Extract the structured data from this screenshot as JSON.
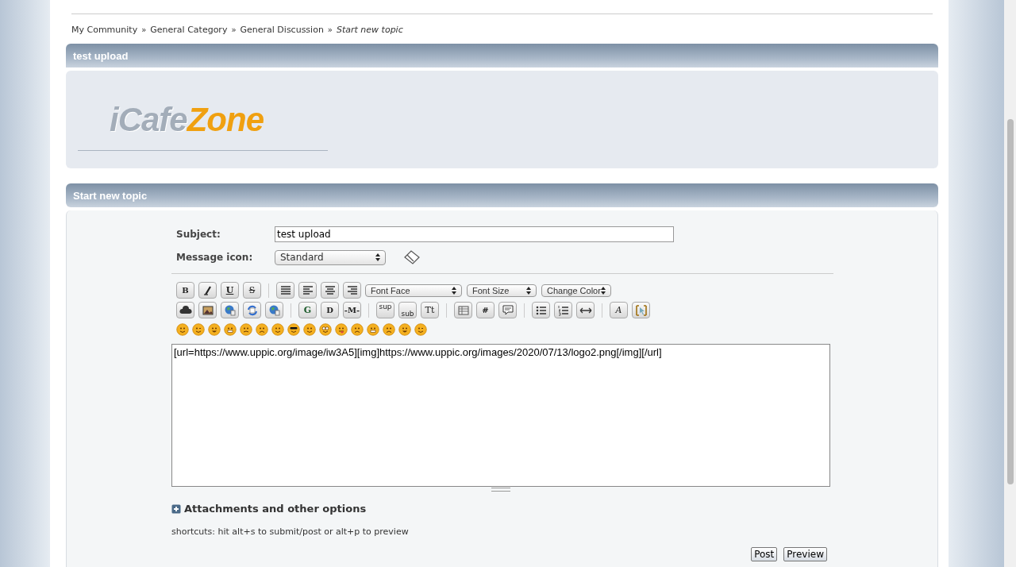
{
  "breadcrumb": [
    {
      "label": "My Community",
      "current": false
    },
    {
      "label": "General Category",
      "current": false
    },
    {
      "label": "General Discussion",
      "current": false
    },
    {
      "label": "Start new topic",
      "current": true
    }
  ],
  "breadcrumb_separator": "»",
  "topic_header": {
    "title": "test upload"
  },
  "logo": {
    "part_1": "iCafe",
    "part_2": "Zone"
  },
  "form_header": {
    "title": "Start new topic"
  },
  "subject": {
    "label": "Subject:",
    "value": "test upload"
  },
  "message_icon": {
    "label": "Message icon:",
    "value": "Standard"
  },
  "toolbar_rows": [
    [
      {
        "kind": "bold",
        "label": "B"
      },
      {
        "kind": "italic"
      },
      {
        "kind": "underline",
        "label": "U"
      },
      {
        "kind": "strike",
        "label": "S"
      },
      {
        "kind": "sep"
      },
      {
        "kind": "justify"
      },
      {
        "kind": "align-left"
      },
      {
        "kind": "align-center"
      },
      {
        "kind": "align-right"
      },
      {
        "kind": "select-wide",
        "label": "Font Face"
      },
      {
        "kind": "select",
        "label": "Font Size"
      },
      {
        "kind": "select",
        "label": "Change Color"
      }
    ],
    [
      {
        "kind": "cloud"
      },
      {
        "kind": "image"
      },
      {
        "kind": "globe"
      },
      {
        "kind": "refresh"
      },
      {
        "kind": "globe"
      },
      {
        "kind": "sep"
      },
      {
        "kind": "circled",
        "label": "G"
      },
      {
        "kind": "bold",
        "label": "D"
      },
      {
        "kind": "bold",
        "label": "-M-"
      },
      {
        "kind": "sep"
      },
      {
        "kind": "sup",
        "label": "sup"
      },
      {
        "kind": "sub",
        "label": "sub"
      },
      {
        "kind": "plain",
        "label": "Tt"
      },
      {
        "kind": "sep"
      },
      {
        "kind": "table"
      },
      {
        "kind": "bold",
        "label": "#"
      },
      {
        "kind": "quote"
      },
      {
        "kind": "sep"
      },
      {
        "kind": "bullets"
      },
      {
        "kind": "numbers"
      },
      {
        "kind": "rule"
      },
      {
        "kind": "sep"
      },
      {
        "kind": "serif",
        "label": "A"
      },
      {
        "kind": "cursor"
      }
    ]
  ],
  "smilies": [
    {
      "kind": "smile"
    },
    {
      "kind": "wink"
    },
    {
      "kind": "grin"
    },
    {
      "kind": "teeth"
    },
    {
      "kind": "angry"
    },
    {
      "kind": "sad"
    },
    {
      "kind": "smile"
    },
    {
      "kind": "cool"
    },
    {
      "kind": "smile"
    },
    {
      "kind": "glasses"
    },
    {
      "kind": "tongue"
    },
    {
      "kind": "sad"
    },
    {
      "kind": "teeth"
    },
    {
      "kind": "sad"
    },
    {
      "kind": "grin"
    },
    {
      "kind": "wink"
    }
  ],
  "message": {
    "value": "[url=https://www.uppic.org/image/iw3A5][img]https://www.uppic.org/images/2020/07/13/logo2.png[/img][/url]"
  },
  "attachments": {
    "label": "Attachments and other options",
    "expanded": false
  },
  "shortcuts": "shortcuts: hit alt+s to submit/post or alt+p to preview",
  "buttons": [
    {
      "label": "Post"
    },
    {
      "label": "Preview"
    }
  ]
}
